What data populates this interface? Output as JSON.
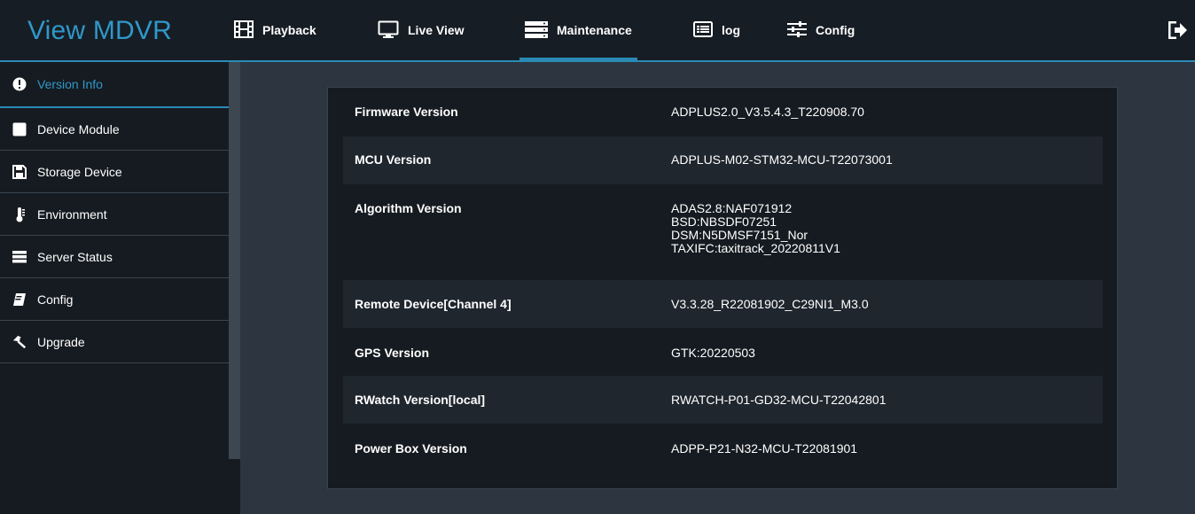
{
  "app": {
    "title": "View MDVR"
  },
  "nav": {
    "items": [
      {
        "label": "Playback",
        "icon": "film-icon"
      },
      {
        "label": "Live View",
        "icon": "monitor-icon"
      },
      {
        "label": "Maintenance",
        "icon": "server-icon",
        "active": true
      },
      {
        "label": "log",
        "icon": "list-icon"
      },
      {
        "label": "Config",
        "icon": "sliders-icon"
      }
    ],
    "logout_icon": "logout-icon"
  },
  "sidebar": {
    "items": [
      {
        "label": "Version Info",
        "icon": "info-icon",
        "active": true
      },
      {
        "label": "Device Module",
        "icon": "square-icon"
      },
      {
        "label": "Storage Device",
        "icon": "floppy-icon"
      },
      {
        "label": "Environment",
        "icon": "thermometer-icon"
      },
      {
        "label": "Server Status",
        "icon": "server-icon"
      },
      {
        "label": "Config",
        "icon": "book-icon"
      },
      {
        "label": "Upgrade",
        "icon": "hammer-icon"
      }
    ]
  },
  "versions": [
    {
      "label": "Firmware Version",
      "value": "ADPLUS2.0_V3.5.4.3_T220908.70"
    },
    {
      "label": "MCU Version",
      "value": "ADPLUS-M02-STM32-MCU-T22073001"
    },
    {
      "label": "Algorithm Version",
      "value_lines": [
        "ADAS2.8:NAF071912",
        "BSD:NBSDF07251",
        "DSM:N5DMSF7151_Nor",
        "TAXIFC:taxitrack_20220811V1"
      ]
    },
    {
      "label": "Remote Device[Channel 4]",
      "value": "V3.3.28_R22081902_C29NI1_M3.0"
    },
    {
      "label": "GPS Version",
      "value": "GTK:20220503"
    },
    {
      "label": "RWatch Version[local]",
      "value": "RWATCH-P01-GD32-MCU-T22042801"
    },
    {
      "label": "Power Box Version",
      "value": "ADPP-P21-N32-MCU-T22081901"
    }
  ],
  "colors": {
    "accent": "#2f98c9",
    "topbar": "#171d24",
    "background": "#2c3540",
    "panel": "#161b21",
    "row_alt": "#1f262e"
  }
}
